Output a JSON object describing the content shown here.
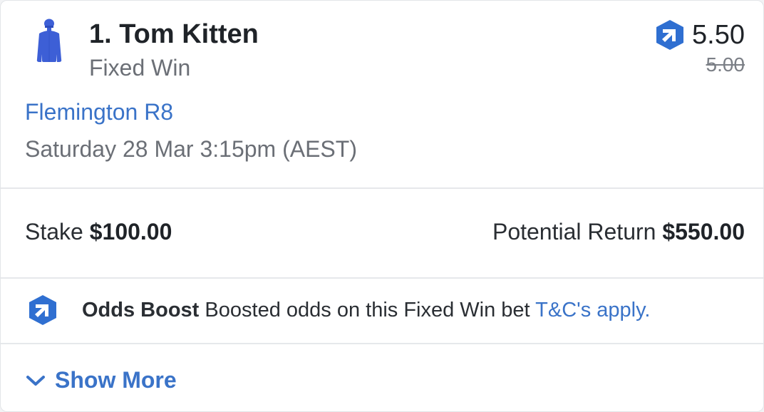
{
  "runner": {
    "name": "1. Tom Kitten",
    "bet_type": "Fixed Win",
    "silks_icon": "jockey-silks-icon",
    "silks_color": "#3d5fd6"
  },
  "odds": {
    "boosted": "5.50",
    "original": "5.00",
    "boost_icon": "odds-boost-icon",
    "boost_color": "#2f6fd1"
  },
  "race": {
    "meeting": "Flemington R8",
    "time": "Saturday 28 Mar 3:15pm (AEST)"
  },
  "stake": {
    "label": "Stake",
    "amount": "$100.00"
  },
  "return": {
    "label": "Potential Return",
    "amount": "$550.00"
  },
  "boost_notice": {
    "title": "Odds Boost",
    "text": "Boosted odds on this Fixed Win bet",
    "link": "T&C's apply."
  },
  "show_more": {
    "label": "Show More",
    "icon": "chevron-down-icon"
  },
  "colors": {
    "accent": "#3a73c8",
    "text": "#1f2328",
    "muted": "#6b6f76"
  }
}
